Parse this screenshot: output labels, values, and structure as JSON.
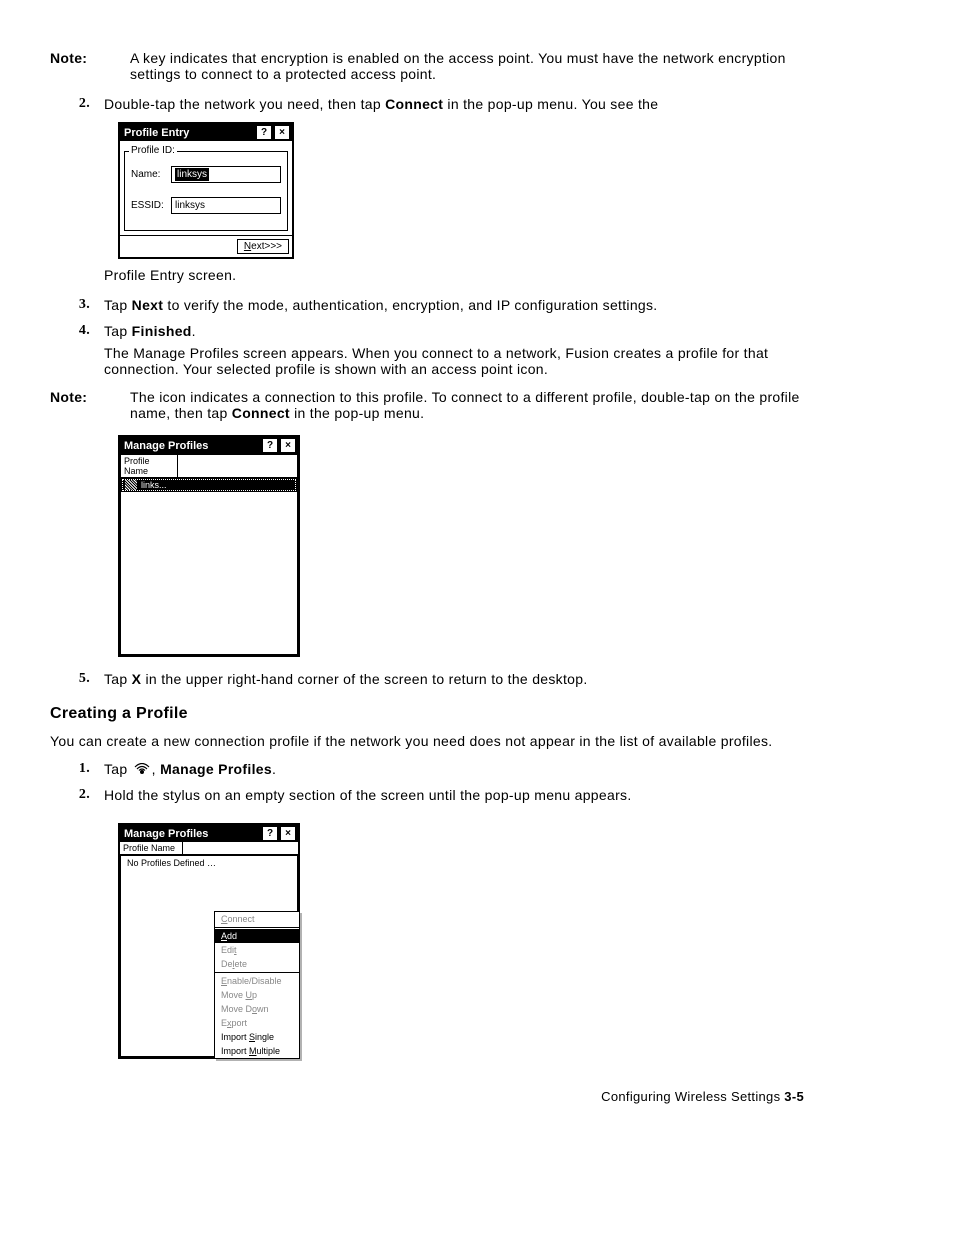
{
  "note1": {
    "label": "Note:",
    "text": "A key indicates that encryption is enabled on the access point. You must have the network encryption settings to connect to a protected access point."
  },
  "step2": {
    "num": "2.",
    "pre": "Double-tap the network you need, then tap ",
    "bold": "Connect",
    "post": " in the pop-up menu. You see the"
  },
  "profileEntry": {
    "title": "Profile Entry",
    "help": "?",
    "close": "×",
    "legend": "Profile ID:",
    "nameLabel": "Name:",
    "nameValue": "linksys",
    "essidLabel": "ESSID:",
    "essidValue": "linksys",
    "nextBtn": "Next>>>",
    "nextU": "N"
  },
  "caption1": "Profile Entry screen.",
  "step3": {
    "num": "3.",
    "pre": "Tap ",
    "bold": "Next",
    "post": " to verify the mode, authentication, encryption, and IP configuration settings."
  },
  "step4": {
    "num": "4.",
    "pre": "Tap ",
    "bold": "Finished",
    "post": "."
  },
  "step4para": "The Manage Profiles screen appears. When you connect to a network, Fusion creates a profile for that connection. Your selected profile is shown with an access point icon.",
  "note2": {
    "label": "Note:",
    "pre": "The icon indicates a connection to this profile. To connect to a different profile, double-tap on the profile name, then tap ",
    "bold": "Connect",
    "post": " in the pop-up menu."
  },
  "manageProfiles1": {
    "title": "Manage Profiles",
    "help": "?",
    "close": "×",
    "header": "Profile Name",
    "row": "links..."
  },
  "step5": {
    "num": "5.",
    "pre": "Tap ",
    "bold": "X",
    "post": " in the upper right-hand corner of the screen to return to the desktop."
  },
  "sectionTitle": "Creating a Profile",
  "sectionIntro": "You can create a new connection profile if the network you need does not appear in the list of available profiles.",
  "cstep1": {
    "num": "1.",
    "pre": "Tap ",
    "post": ", ",
    "bold": "Manage Profiles",
    "end": "."
  },
  "cstep2": {
    "num": "2.",
    "text": "Hold the stylus on an empty section of the screen until the pop-up menu appears."
  },
  "manageProfiles2": {
    "title": "Manage Profiles",
    "help": "?",
    "close": "×",
    "header": "Profile Name",
    "empty": "No Profiles Defined …",
    "menu": {
      "connect": "Connect",
      "add": "Add",
      "edit": "Edit",
      "delete": "Delete",
      "enable": "Enable/Disable",
      "moveup": "Move Up",
      "movedown": "Move Down",
      "export": "Export",
      "impS": "Import Single",
      "impM": "Import Multiple"
    }
  },
  "footer": {
    "text": "Configuring Wireless Settings  ",
    "page": "3-5"
  }
}
